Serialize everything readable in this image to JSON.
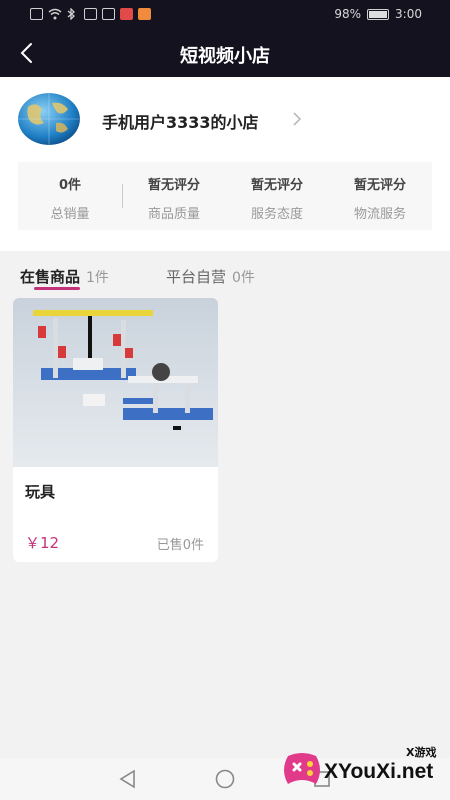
{
  "status_bar": {
    "battery_text": "98%",
    "battery_level": 0.98,
    "time": "3:00"
  },
  "header": {
    "title": "短视频小店",
    "back_icon": "back-arrow-icon"
  },
  "shop": {
    "name": "手机用户3333的小店",
    "avatar_icon": "globe-avatar",
    "stats": [
      {
        "value": "0件",
        "label": "总销量"
      },
      {
        "value": "暂无评分",
        "label": "商品质量"
      },
      {
        "value": "暂无评分",
        "label": "服务态度"
      },
      {
        "value": "暂无评分",
        "label": "物流服务"
      }
    ]
  },
  "tabs": [
    {
      "name": "在售商品",
      "count": "1件",
      "active": true
    },
    {
      "name": "平台自营",
      "count": "0件",
      "active": false
    }
  ],
  "products": [
    {
      "title": "玩具",
      "price": "￥12",
      "sold": "已售0件"
    }
  ],
  "watermark": {
    "small": "X游戏",
    "text": "XYouXi.net"
  },
  "colors": {
    "header_bg": "#14121f",
    "accent": "#c2337a",
    "page_bg": "#f2f2f2"
  }
}
